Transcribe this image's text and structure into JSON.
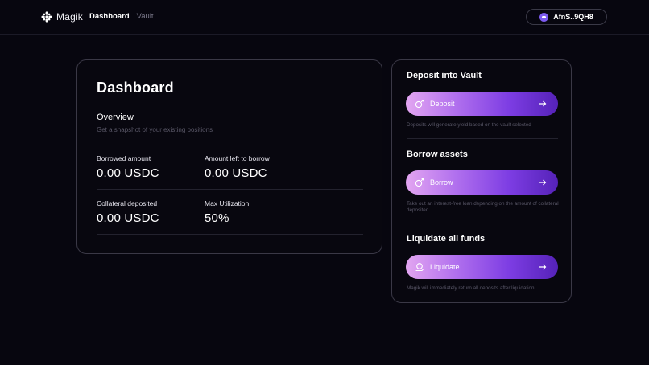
{
  "app": {
    "brand": "Magik",
    "nav": [
      {
        "label": "Dashboard",
        "active": true
      },
      {
        "label": "Vault",
        "active": false
      }
    ],
    "wallet_address": "AfnS..9QH8"
  },
  "dashboard": {
    "title": "Dashboard",
    "overview_title": "Overview",
    "overview_subtitle": "Get a snapshot of your existing positions",
    "stats": [
      {
        "label": "Borrowed amount",
        "value": "0.00 USDC"
      },
      {
        "label": "Amount left to borrow",
        "value": "0.00 USDC"
      },
      {
        "label": "Collateral deposited",
        "value": "0.00 USDC"
      },
      {
        "label": "Max Utilization",
        "value": "50%"
      }
    ]
  },
  "actions": [
    {
      "title": "Deposit into Vault",
      "button": "Deposit",
      "icon": "coin-icon",
      "hint": "Deposits will generate yield based on the vault selected"
    },
    {
      "title": "Borrow assets",
      "button": "Borrow",
      "icon": "coin-icon",
      "hint": "Take out an interest-free loan depending on the amount of collateral deposited"
    },
    {
      "title": "Liquidate all funds",
      "button": "Liquidate",
      "icon": "hand-coin-icon",
      "hint": "Magik will immediately return all deposits after liquidation"
    }
  ],
  "colors": {
    "background": "#07060f",
    "accent_start": "#e3a6f1",
    "accent_end": "#5522b8",
    "wallet_dot": "#7d5bf0"
  }
}
